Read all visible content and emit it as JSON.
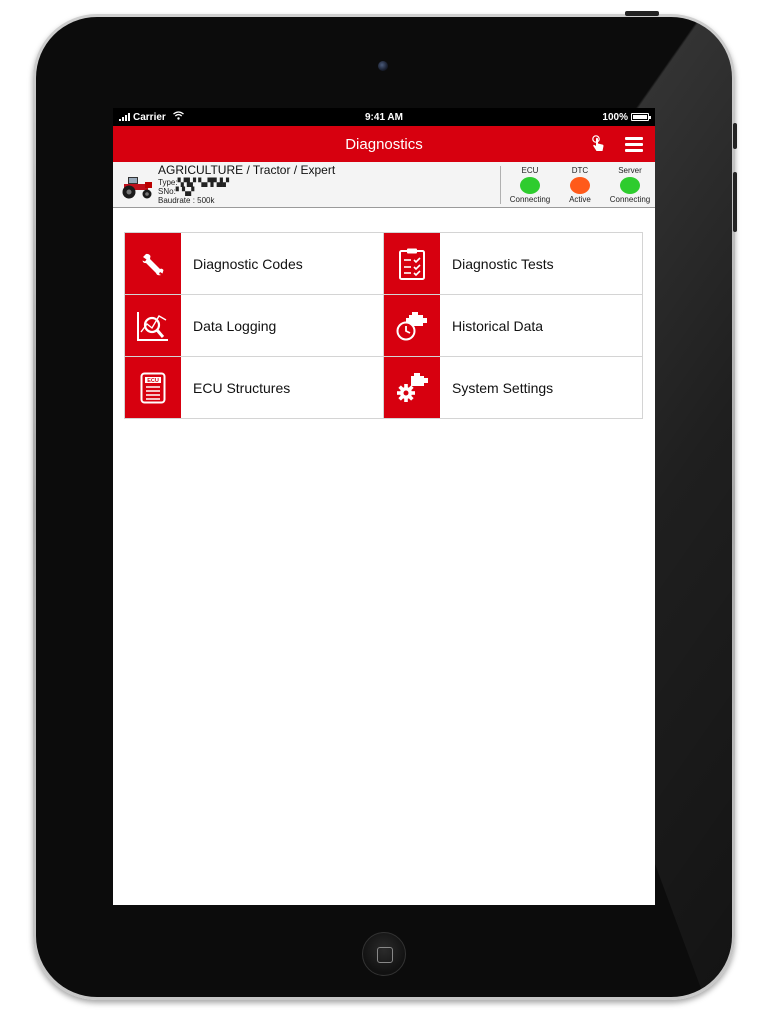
{
  "status_bar": {
    "carrier": "Carrier",
    "time": "9:41 AM",
    "battery": "100%"
  },
  "nav": {
    "title": "Diagnostics",
    "icons": [
      "touch-icon",
      "menu-icon"
    ]
  },
  "vehicle": {
    "title": "AGRICULTURE / Tractor / Expert",
    "type_line": "Type:▚▜▞ ▚▞▛▟▞",
    "serial_line": "SNo:▘▚▞",
    "baudrate_line": "Baudrate : 500k"
  },
  "indicators": [
    {
      "label": "ECU",
      "status": "Connecting",
      "color": "#2ecc2e"
    },
    {
      "label": "DTC",
      "status": "Active",
      "color": "#ff5a1a"
    },
    {
      "label": "Server",
      "status": "Connecting",
      "color": "#2ecc2e"
    }
  ],
  "menu": [
    {
      "label": "Diagnostic Codes",
      "icon": "wrench-icon"
    },
    {
      "label": "Diagnostic Tests",
      "icon": "clipboard-checklist-icon"
    },
    {
      "label": "Data Logging",
      "icon": "chart-magnifier-icon"
    },
    {
      "label": "Historical Data",
      "icon": "engine-clock-icon"
    },
    {
      "label": "ECU Structures",
      "icon": "ecu-document-icon"
    },
    {
      "label": "System Settings",
      "icon": "engine-gear-icon"
    }
  ],
  "colors": {
    "accent": "#d7000f",
    "status_ok": "#2ecc2e",
    "status_active": "#ff5a1a"
  }
}
